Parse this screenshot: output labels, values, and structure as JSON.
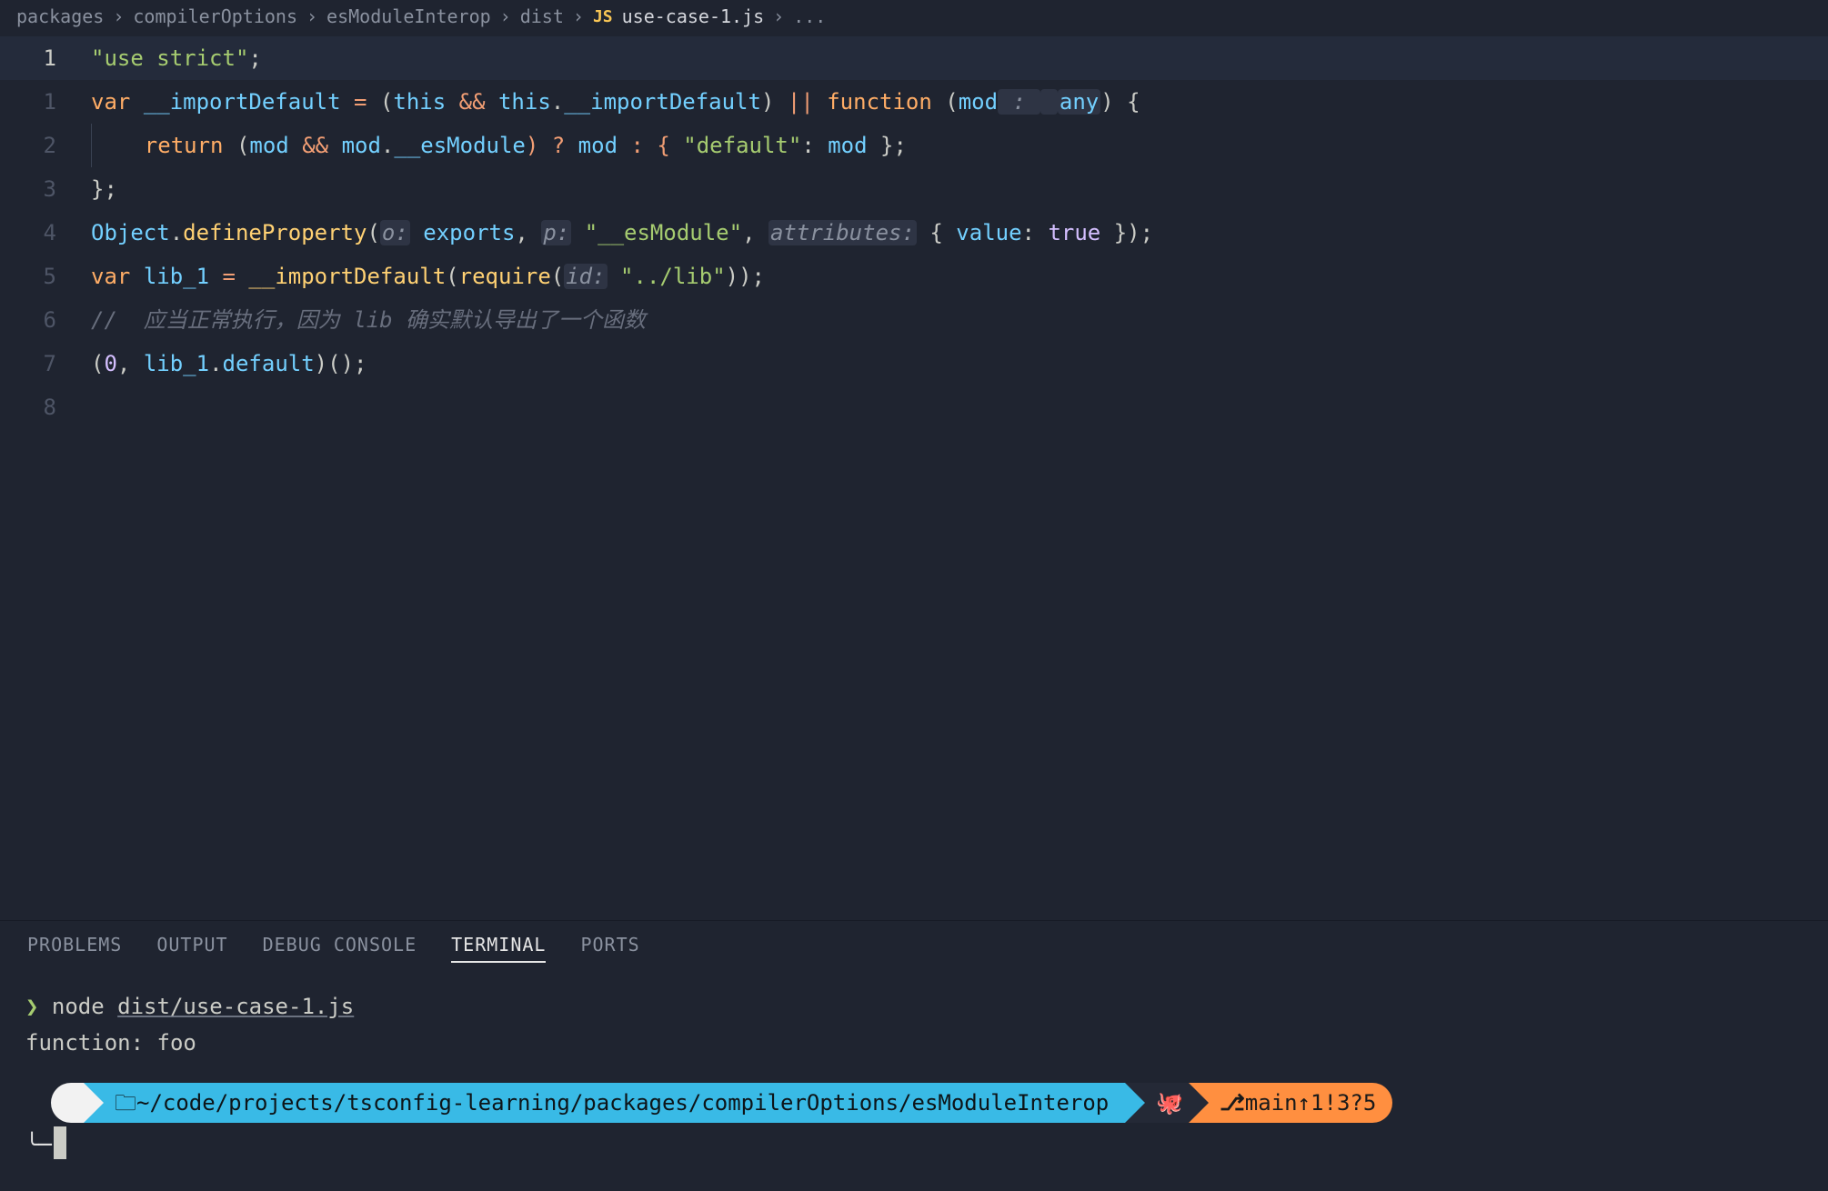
{
  "breadcrumb": {
    "seg1": "packages",
    "seg2": "compilerOptions",
    "seg3": "esModuleInterop",
    "seg4": "dist",
    "icon": "JS",
    "file": "use-case-1.js",
    "tail": "..."
  },
  "gutter": [
    "1",
    "1",
    "2",
    "3",
    "4",
    "5",
    "6",
    "7",
    "8"
  ],
  "code": {
    "l1": {
      "t": "\"use strict\"",
      ";": ";"
    },
    "l2": {
      "var": "var",
      "sp": " ",
      "id": "__importDefault",
      "eq": " = ",
      "op1": "(",
      "this1": "this",
      "and": " && ",
      "this2": "this",
      "dot": ".",
      "id2": "__importDefault",
      "cp": ")",
      "or": " || ",
      "fn": "function ",
      "op2": "(",
      "mod": "mod",
      "hint": " : ",
      "any": "any",
      "cp2": ") {"
    },
    "l3": {
      "ret": "return",
      "sp": " (",
      "mod": "mod",
      "and": " && ",
      "mod2": "mod",
      "dot": ".",
      "es": "__esModule",
      "q": ") ? ",
      "mod3": "mod",
      "col": " : { ",
      "def": "\"default\"",
      "c2": ": ",
      "mod4": "mod",
      "end": " };"
    },
    "l4": {
      "t": "};"
    },
    "l5": {
      "obj": "Object",
      "dot": ".",
      "dp": "defineProperty",
      "op": "(",
      "h1": "o:",
      "sp": " ",
      "exp": "exports",
      "c": ", ",
      "h2": "p:",
      "sp2": " ",
      "es": "\"__esModule\"",
      "c2": ", ",
      "h3": "attributes:",
      "sp3": " ",
      "ob": "{ ",
      "val": "value",
      "col": ": ",
      "tru": "true",
      "cb": " }",
      ");": ");"
    },
    "l6": {
      "var": "var",
      "sp": " ",
      "lib": "lib_1",
      "eq": " = ",
      "id": "__importDefault",
      "op": "(",
      "req": "require",
      "op2": "(",
      "h": "id:",
      "sp2": " ",
      "str": "\"../lib\"",
      "cp": "));"
    },
    "l7": {
      "t": "//  应当正常执行，因为 lib 确实默认导出了一个函数"
    },
    "l8": {
      "op": "(",
      "z": "0",
      "c": ", ",
      "lib": "lib_1",
      "dot": ".",
      "def": "default",
      "cp": ")();"
    },
    "l9": ""
  },
  "panel": {
    "tabs": {
      "problems": "PROBLEMS",
      "output": "OUTPUT",
      "debug": "DEBUG CONSOLE",
      "terminal": "TERMINAL",
      "ports": "PORTS"
    },
    "term": {
      "prompt": "❯",
      "cmd": "node",
      "arg": "dist/use-case-1.js",
      "out": "function: foo"
    },
    "pl": {
      "path": "~/code/projects/tsconfig-learning/packages/compilerOptions/esModuleInterop",
      "branch": "main",
      "ahead": "↑1",
      "dirty": "!3",
      "untracked": "?5"
    }
  }
}
